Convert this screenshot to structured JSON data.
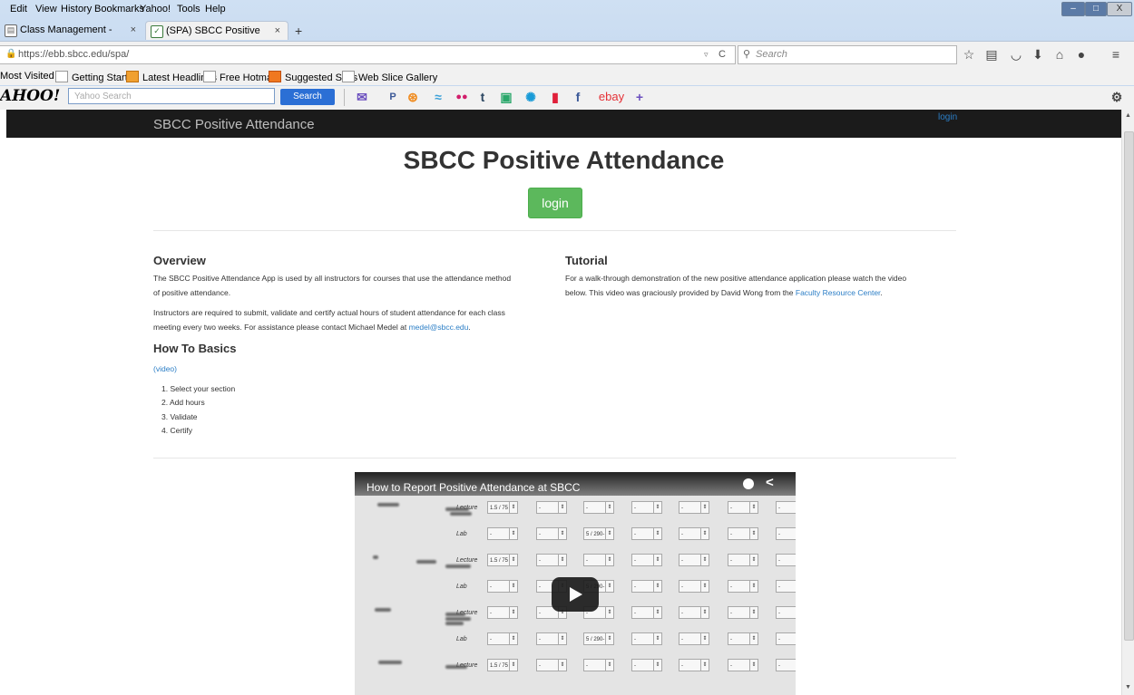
{
  "menubar": {
    "items": [
      "Edit",
      "View",
      "History",
      "Bookmarks",
      "Yahoo!",
      "Tools",
      "Help"
    ]
  },
  "tabs": [
    {
      "label": "Class Management - SBCC...",
      "close": "×"
    },
    {
      "label": "(SPA) SBCC Positive Atten...",
      "close": "×"
    }
  ],
  "new_tab": "+",
  "navbar": {
    "url": "https://ebb.sbcc.edu/spa/",
    "search_placeholder": "Search"
  },
  "bookmarks": [
    "Most Visited",
    "Getting Started",
    "Latest Headlines",
    "Free Hotmail",
    "Suggested Sites",
    "Web Slice Gallery"
  ],
  "yahoo": {
    "logo": "AHOO!",
    "search_placeholder": "Yahoo Search",
    "search_button": "Search",
    "ebay": "ebay",
    "plus": "+"
  },
  "site": {
    "brand": "SBCC Positive Attendance",
    "nav_login": "login",
    "title": "SBCC Positive Attendance",
    "login_button": "login"
  },
  "overview": {
    "heading": "Overview",
    "para1_line1": "The SBCC Positive Attendance App is used by all instructors for courses that use the attendance method",
    "para1_line2": "of positive attendance.",
    "para2_line1": "Instructors are required to submit, validate and certify actual hours of student attendance for each class",
    "para2_line2_text": "meeting every two weeks. For assistance please contact Michael Medel at ",
    "para2_email": "medel@sbcc.edu",
    "para2_end": "."
  },
  "howto": {
    "heading": "How To Basics",
    "video_open": "(",
    "video_link": "video",
    "video_close": ")",
    "steps": [
      "1. Select your section",
      "2. Add hours",
      "3. Validate",
      "4. Certify"
    ]
  },
  "tutorial": {
    "heading": "Tutorial",
    "line1": "For a walk-through demonstration of the new positive attendance application please watch the video",
    "line2_text": "below. This video was graciously provided by David Wong from the ",
    "line2_link": "Faculty Resource Center",
    "line2_end": "."
  },
  "video": {
    "title": "How to Report Positive Attendance at SBCC",
    "rows": [
      {
        "label": "Lecture",
        "cells": [
          "1.5 / 75",
          "-",
          "-",
          "-",
          "-",
          "-",
          "-"
        ]
      },
      {
        "label": "Lab",
        "cells": [
          "-",
          "-",
          "5 / 290-",
          "-",
          "-",
          "-",
          "-"
        ]
      },
      {
        "label": "Lecture",
        "cells": [
          "1.5 / 75",
          "-",
          "-",
          "-",
          "-",
          "-",
          "-"
        ]
      },
      {
        "label": "Lab",
        "cells": [
          "-",
          "-",
          "5 / 290-",
          "-",
          "-",
          "-",
          "-"
        ]
      },
      {
        "label": "Lecture",
        "cells": [
          "-",
          "-",
          "-",
          "-",
          "-",
          "-",
          "-"
        ]
      },
      {
        "label": "Lab",
        "cells": [
          "-",
          "-",
          "5 / 290-",
          "-",
          "-",
          "-",
          "-"
        ]
      },
      {
        "label": "Lecture",
        "cells": [
          "1.5 / 75",
          "-",
          "-",
          "-",
          "-",
          "-",
          "-"
        ]
      }
    ]
  }
}
